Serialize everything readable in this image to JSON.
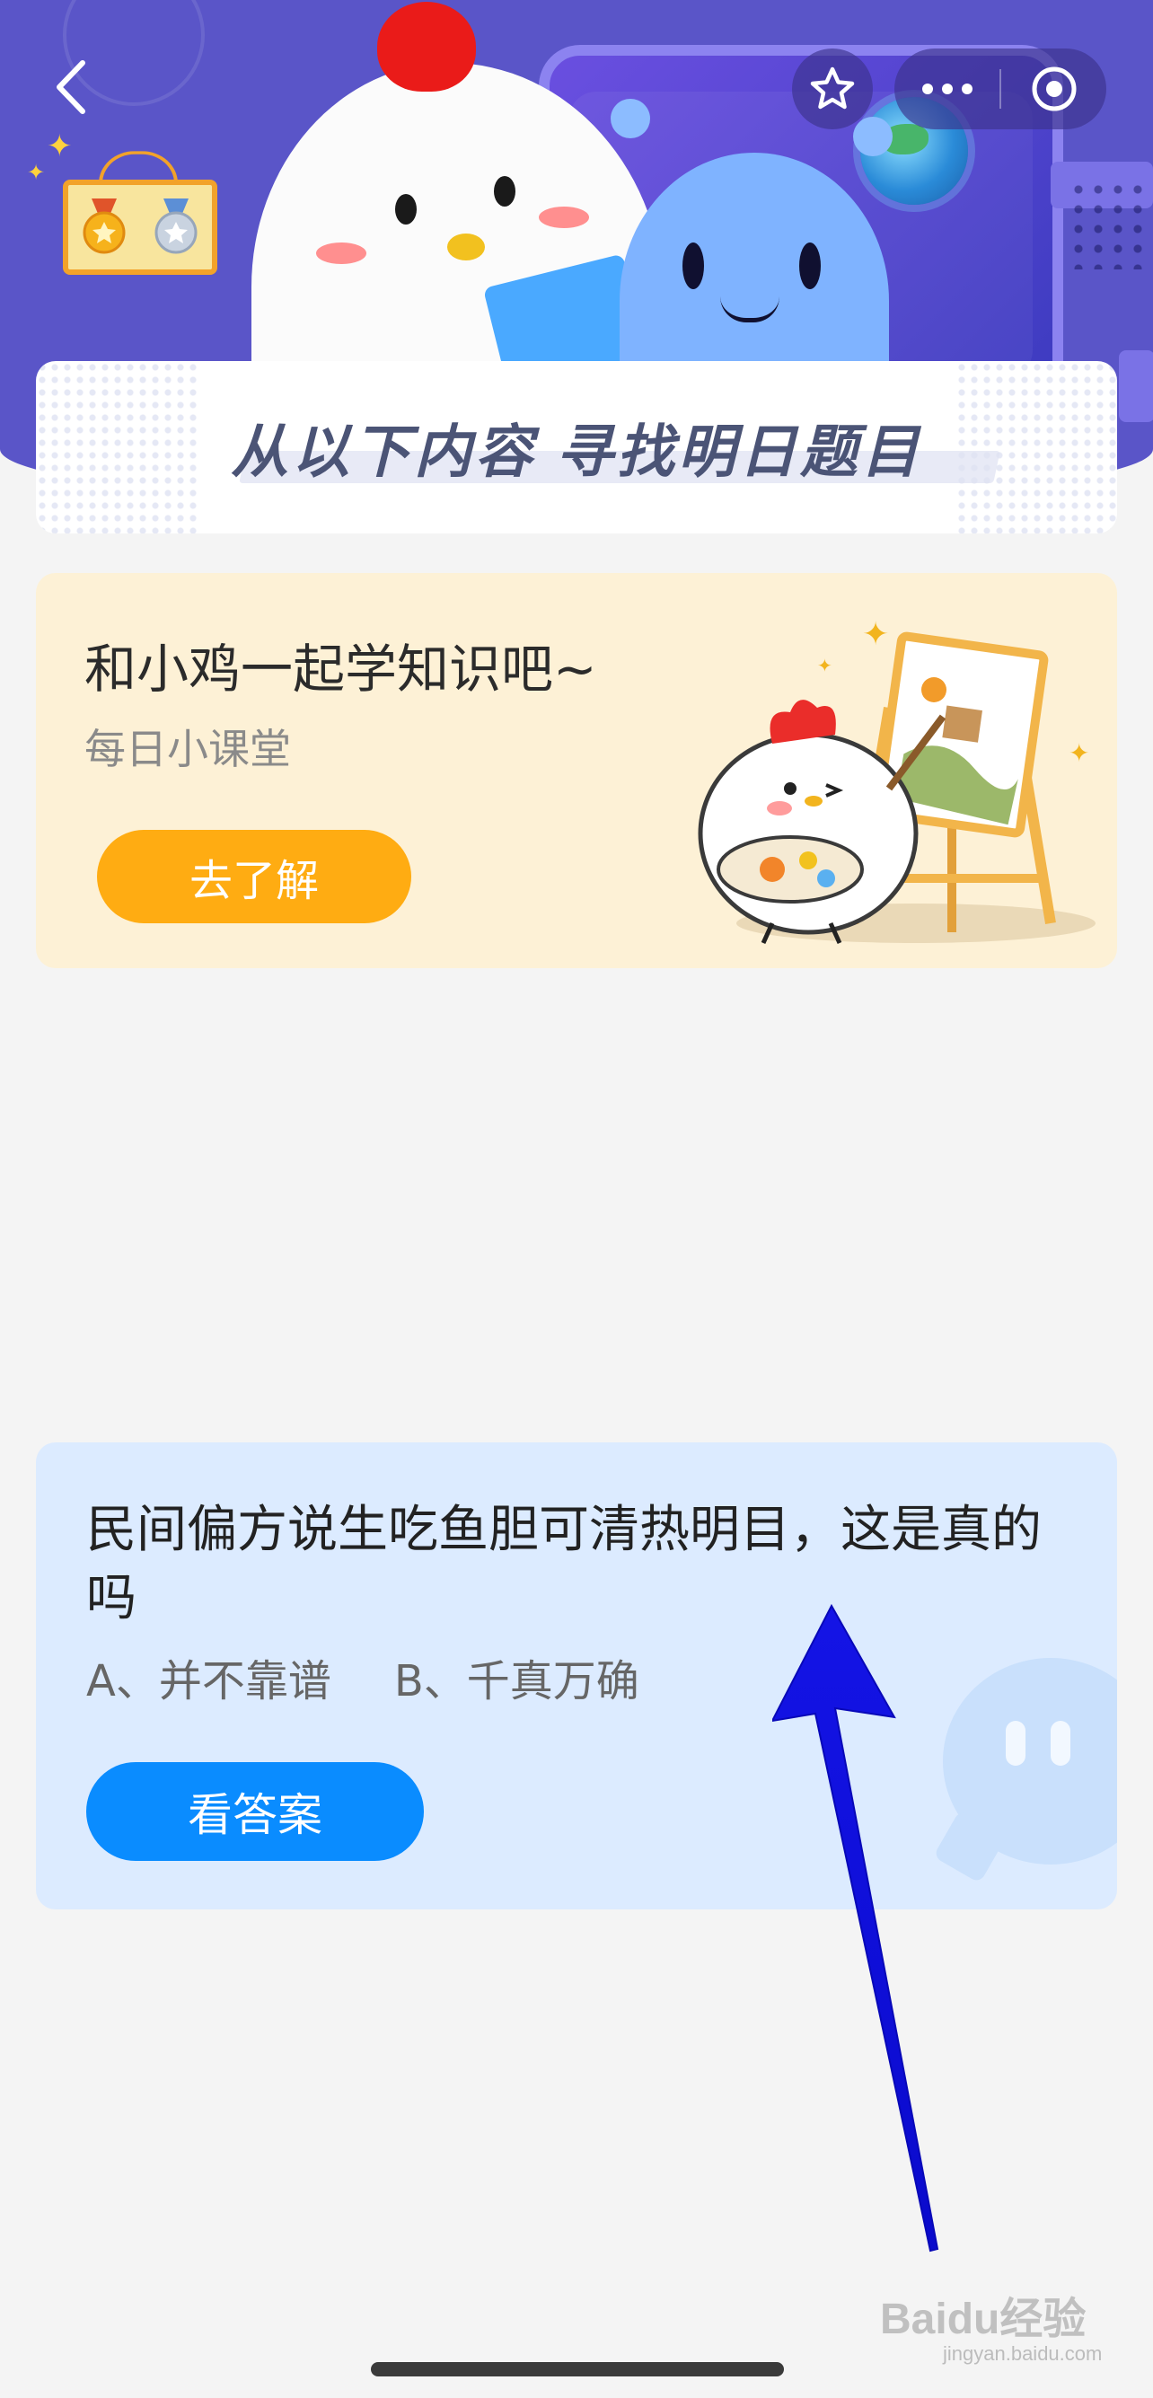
{
  "nav": {
    "back_icon": "chevron-left-icon",
    "favorite_icon": "star-icon",
    "more_icon": "more-dots-icon",
    "close_icon": "target-circle-icon"
  },
  "banner": {
    "title": "从以下内容  寻找明日题目"
  },
  "learn_card": {
    "title": "和小鸡一起学知识吧~",
    "subtitle": "每日小课堂",
    "button_label": "去了解"
  },
  "question_card": {
    "question": "民间偏方说生吃鱼胆可清热明目，这是真的吗",
    "options": [
      "A、并不靠谱",
      "B、千真万确"
    ],
    "button_label": "看答案"
  },
  "watermark": {
    "logo": "Baidu经验",
    "url": "jingyan.baidu.com"
  },
  "colors": {
    "header_bg": "#5a55c8",
    "learn_card_bg": "#fdf1d6",
    "learn_button": "#ffac12",
    "question_card_bg": "#dcebff",
    "answer_button": "#0a8cff",
    "arrow": "#1010e0"
  }
}
